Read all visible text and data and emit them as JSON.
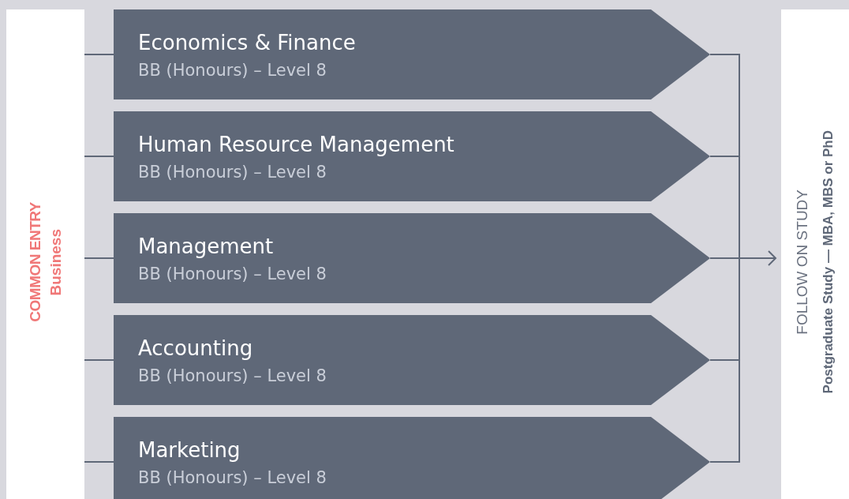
{
  "entry": {
    "title": "COMMON ENTRY",
    "subtitle": "Business"
  },
  "programmes": [
    {
      "title": "Economics & Finance",
      "award": "BB (Honours) – Level 8"
    },
    {
      "title": "Human Resource Management",
      "award": "BB (Honours) – Level 8"
    },
    {
      "title": "Management",
      "award": "BB (Honours) – Level 8"
    },
    {
      "title": "Accounting",
      "award": "BB (Honours) – Level 8"
    },
    {
      "title": "Marketing",
      "award": "BB (Honours) – Level 8"
    }
  ],
  "follow_on": {
    "heading": "FOLLOW ON STUDY",
    "text": "Postgraduate Study — MBA, MBS or PhD"
  }
}
